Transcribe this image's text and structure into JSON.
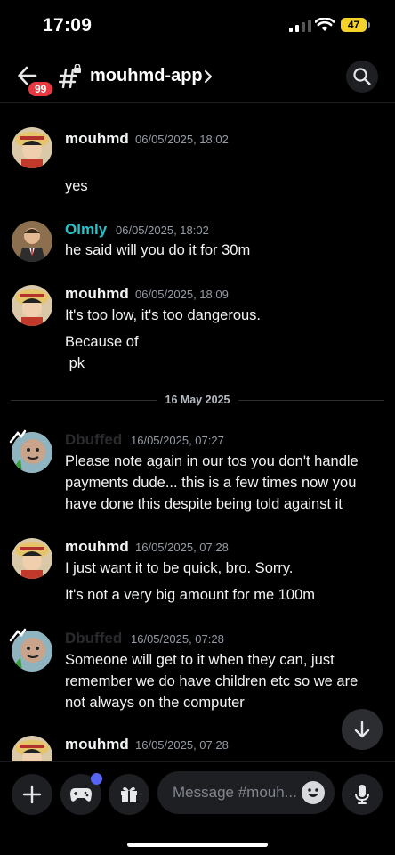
{
  "status_bar": {
    "time": "17:09",
    "battery": "47"
  },
  "header": {
    "unread_badge": "99",
    "channel_name": "mouhmd-app"
  },
  "messages": [
    {
      "author": "mouhmd",
      "timestamp": "06/05/2025, 18:02",
      "lines": [
        "yes"
      ]
    },
    {
      "author": "Olmly",
      "timestamp": "06/05/2025, 18:02",
      "lines": [
        "he said will you do it for 30m"
      ]
    },
    {
      "author": "mouhmd",
      "timestamp": "06/05/2025, 18:09",
      "lines": [
        "It's too low, it's too dangerous.",
        "Because of",
        " pk"
      ]
    },
    {
      "author": "Dbuffed",
      "timestamp": "16/05/2025, 07:27",
      "lines": [
        "Please note again in our tos you don't handle",
        "payments dude... this is a few times now you",
        "have done this despite being told against it"
      ]
    },
    {
      "author": "mouhmd",
      "timestamp": "16/05/2025, 07:28",
      "lines": [
        "I just want it to be quick, bro. Sorry.",
        "It's not a very big amount for me 100m"
      ]
    },
    {
      "author": "Dbuffed",
      "timestamp": "16/05/2025, 07:28",
      "lines": [
        "Someone will get to it when they can, just",
        "remember we do have children etc so we are",
        "not always on the computer"
      ]
    },
    {
      "author": "mouhmd",
      "timestamp": "16/05/2025, 07:28",
      "lines": []
    }
  ],
  "date_divider": "16 May 2025",
  "composer": {
    "placeholder": "Message #mouh..."
  },
  "colors": {
    "accent": "#5865f2",
    "teal_name": "#2ac1c8",
    "badge_red": "#e7393f",
    "battery": "#f4d12b"
  },
  "icons": [
    "back-arrow-icon",
    "locked-hash-icon",
    "chevron-right-icon",
    "search-icon",
    "arrow-down-icon",
    "plus-icon",
    "gamepad-icon",
    "gift-icon",
    "emoji-icon",
    "microphone-icon"
  ]
}
